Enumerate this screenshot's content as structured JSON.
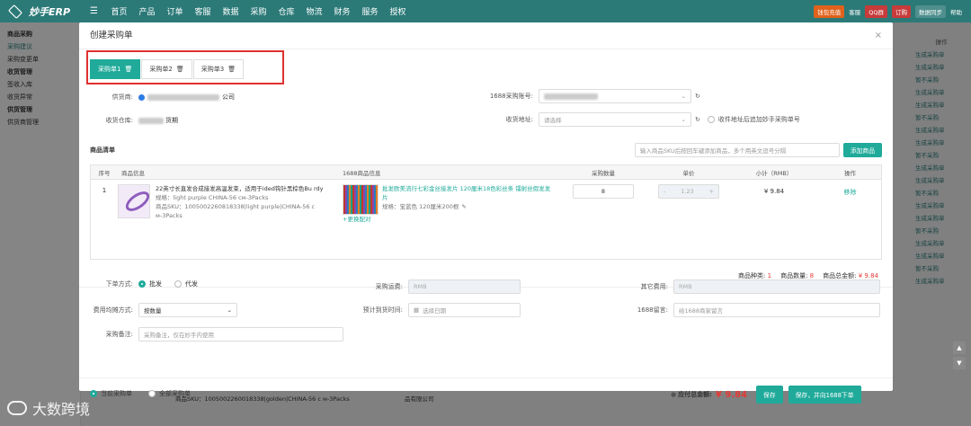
{
  "app": {
    "logo_text": "妙手ERP"
  },
  "topnav": {
    "items": [
      "首页",
      "产品",
      "订单",
      "客服",
      "数据",
      "采购",
      "仓库",
      "物流",
      "财务",
      "服务",
      "授权"
    ],
    "right": {
      "promo": "钱包充值",
      "service": "客服",
      "qq": "QQ群",
      "order": "订购",
      "sync": "数据同步",
      "help": "帮助"
    }
  },
  "sidebar": {
    "items": [
      "商品采购",
      "采购建议",
      "采购变更单",
      "收货管理",
      "签收入库",
      "收货异常",
      "供货管理",
      "供货商管理"
    ]
  },
  "background_ops": [
    "操作",
    "生成采购单",
    "生成采购单",
    "暂不采购",
    "生成采购单",
    "生成采购单",
    "暂不采购",
    "生成采购单",
    "生成采购单",
    "暂不采购",
    "生成采购单",
    "生成采购单",
    "暂不采购",
    "生成采购单",
    "生成采购单",
    "暂不采购",
    "生成采购单",
    "生成采购单",
    "暂不采购",
    "生成采购单"
  ],
  "background_row": {
    "sku_text": "商品SKU：1005002260018338|golden|CHINA-56 c м-3Packs",
    "company": "品有限公司"
  },
  "modal": {
    "title": "创建采购单",
    "close": "×",
    "tabs": [
      {
        "label": "采购单1",
        "active": true
      },
      {
        "label": "采购单2",
        "active": false
      },
      {
        "label": "采购单3",
        "active": false
      }
    ],
    "supplier_label": "供货商:",
    "supplier_suffix": "公司",
    "account_label": "1688采购账号:",
    "warehouse_label": "收货仓库:",
    "warehouse_suffix": "货期",
    "address_label": "收货地址:",
    "address_placeholder": "请选择",
    "address_checkbox": "收件地址后追加妙手采购单号",
    "list_title": "商品清单",
    "sku_search_placeholder": "输入商品SKU后按回车键添加商品，多个用英文逗号分隔",
    "add_button": "添加商品",
    "table_headers": [
      "序号",
      "商品信息",
      "1688商品信息",
      "采购数量",
      "单价",
      "小计（RMB）",
      "操作"
    ],
    "item": {
      "index": "1",
      "title": "22英寸长直发合成接发高温发束，适用于ided钩针黑棕色Bu rdy",
      "spec": "规格：light purple CHINA-56 см-3Packs",
      "sku": "商品SKU：1005002260818338|light purple|CHINA-56 c м-3Packs",
      "title_1688": "批发欧美流行七彩金丝接发片 120厘米18色彩丝条 镭射丝假发发片",
      "spec_1688": "规格：宝蓝色 120厘米200根",
      "change_link": "+更换配对",
      "qty": "8",
      "price": "1.23",
      "subtotal": "¥ 9.84",
      "remove": "移除"
    },
    "summary": {
      "kinds_label": "商品种类:",
      "kinds": "1",
      "count_label": "商品数量:",
      "count": "8",
      "total_label": "商品总金额:",
      "total": "¥ 9.84"
    },
    "order_method_label": "下单方式:",
    "order_methods": [
      "批发",
      "代发"
    ],
    "freight_label": "采购运费:",
    "currency": "RMB",
    "other_fee_label": "其它费用:",
    "alloc_label": "费用均摊方式:",
    "alloc_value": "按数量",
    "eta_label": "预计到货时间:",
    "eta_placeholder": "选择日期",
    "msg_label": "1688留言:",
    "msg_placeholder": "给1688商家留言",
    "remark_label": "采购备注:",
    "remark_placeholder": "采购备注，仅在妙手内使用",
    "scope_options": [
      "当前采购单",
      "全部采购单"
    ],
    "payable_label": "应付总金额:",
    "payable": "¥ 9.84",
    "save_button": "保存",
    "save_push_button": "保存，并向1688下单"
  },
  "watermark": "大数跨境"
}
